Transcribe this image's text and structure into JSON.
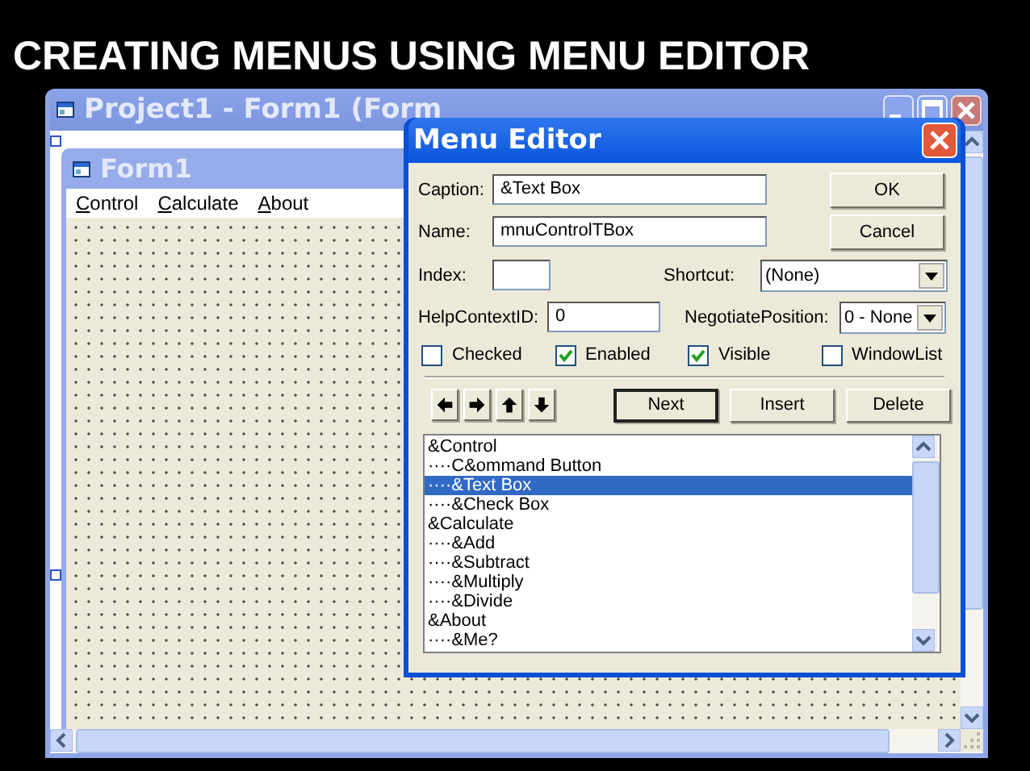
{
  "slide_title": "CREATING MENUS USING MENU EDITOR",
  "ide_window": {
    "title": "Project1 - Form1 (Form"
  },
  "form": {
    "title": "Form1",
    "menu": [
      "Control",
      "Calculate",
      "About"
    ]
  },
  "menu_editor": {
    "title": "Menu Editor",
    "caption": {
      "label": "Caption:",
      "value": "&Text Box"
    },
    "name": {
      "label": "Name:",
      "value": "mnuControlTBox"
    },
    "index": {
      "label": "Index:"
    },
    "shortcut": {
      "label": "Shortcut:",
      "value": "(None)"
    },
    "help_context_id": {
      "label": "HelpContextID:",
      "value": "0"
    },
    "negotiate_position": {
      "label": "NegotiatePosition:",
      "value": "0 - None"
    },
    "checkboxes": [
      {
        "label": "Checked",
        "checked": false
      },
      {
        "label": "Enabled",
        "checked": true
      },
      {
        "label": "Visible",
        "checked": true
      },
      {
        "label": "WindowList",
        "checked": false
      }
    ],
    "dialog_buttons": [
      "OK",
      "Cancel"
    ],
    "edit_buttons": [
      {
        "label": "Next",
        "default": true
      },
      {
        "label": "Insert",
        "default": false
      },
      {
        "label": "Delete",
        "default": false
      }
    ],
    "menu_list": [
      {
        "text": "&Control",
        "selected": false,
        "children": [
          {
            "text": "····C&ommand Button",
            "selected": false
          },
          {
            "text": "····&Text Box",
            "selected": true
          },
          {
            "text": "····&Check Box",
            "selected": false
          }
        ]
      },
      {
        "text": "&Calculate",
        "selected": false,
        "children": [
          {
            "text": "····&Add",
            "selected": false
          },
          {
            "text": "····&Subtract",
            "selected": false
          },
          {
            "text": "····&Multiply",
            "selected": false
          },
          {
            "text": "····&Divide",
            "selected": false
          }
        ]
      },
      {
        "text": "&About",
        "selected": false,
        "children": [
          {
            "text": "····&Me?",
            "selected": false
          }
        ]
      }
    ]
  }
}
